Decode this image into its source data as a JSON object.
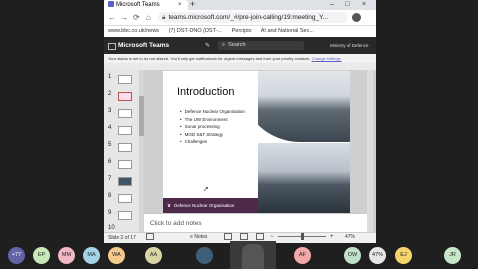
{
  "browser": {
    "tab_title": "Microsoft Teams",
    "tab_close": "×",
    "new_tab": "+",
    "window_controls": [
      "–",
      "□",
      "×"
    ],
    "nav": {
      "back": "←",
      "forward": "→",
      "reload": "⟳",
      "home": "⌂"
    },
    "url": "teams.microsoft.com/_#/pre-join-calling/19:meeting_Y...",
    "bookmarks": [
      "www.bbc.co.uk/news",
      "(7) DST-DNO (DST-...",
      "Percipio",
      "AI and National Sec..."
    ]
  },
  "teams": {
    "app_title": "Microsoft Teams",
    "search_placeholder": "Search",
    "org": "Ministry of Defence",
    "status_message": "Your status is set to do not disturb. You'll only get notifications for urgent messages and from your priority contacts.",
    "status_link": "Change settings."
  },
  "ppt": {
    "thumb_numbers": [
      "1",
      "2",
      "3",
      "4",
      "5",
      "6",
      "7",
      "8",
      "9",
      "10"
    ],
    "selected_thumb": 2,
    "slide": {
      "title": "Introduction",
      "bullets": [
        "Defence Nuclear Organisation",
        "The UW Environment",
        "Sonar processing",
        "MOD S&T Strategy",
        "Challenges"
      ],
      "footer": "Defence Nuclear Organisation"
    },
    "notes_placeholder": "Click to add notes",
    "status": {
      "slide_counter": "Slide 2 of 17",
      "notes_label": "Notes",
      "zoom": "47%"
    }
  },
  "participants": [
    {
      "initials": "+77",
      "name": "",
      "color": "#6264a7"
    },
    {
      "initials": "EP",
      "name": "",
      "color": "#c7e8b9"
    },
    {
      "initials": "MM",
      "name": "",
      "color": "#f2b8c6"
    },
    {
      "initials": "MA",
      "name": "",
      "color": "#a5d3e6"
    },
    {
      "initials": "WA",
      "name": "",
      "color": "#f4c98b"
    },
    {
      "initials": "AA",
      "name": "",
      "color": "#d9d4a5"
    },
    {
      "initials": "",
      "name": "",
      "color": "#3d5f7a"
    },
    {
      "initials": "AF",
      "name": "",
      "color": "#f2a8a8"
    },
    {
      "initials": "OW",
      "name": "",
      "color": "#bfe0c9"
    },
    {
      "initials": "47%",
      "name": "",
      "color": "#e6e6e6"
    },
    {
      "initials": "EJ",
      "name": "",
      "color": "#f6d36b"
    },
    {
      "initials": "JR",
      "name": "",
      "color": "#c8e6c9"
    }
  ]
}
